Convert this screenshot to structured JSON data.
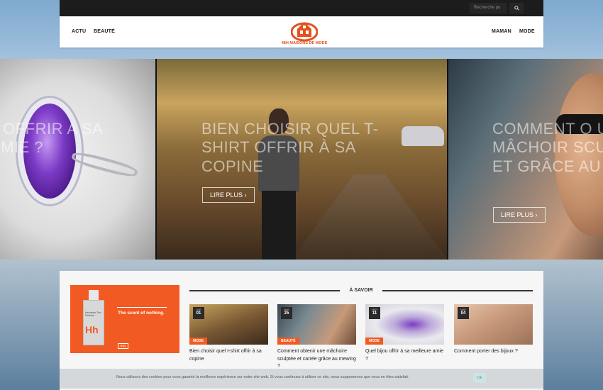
{
  "search": {
    "placeholder": "Recherche pu"
  },
  "nav": {
    "left": [
      "ACTU",
      "BEAUTÉ"
    ],
    "right": [
      "MAMAN",
      "MODE"
    ]
  },
  "logo": {
    "text": "48H MAISONS DE MODE"
  },
  "slides": [
    {
      "title": "J OFFRIR A SA AMIE ?",
      "button": ""
    },
    {
      "title": "BIEN CHOISIR QUEL T-SHIRT OFFRIR À SA COPINE",
      "button": "LIRE PLUS"
    },
    {
      "title": "COMMENT O UNE MÂCHOIR SCULPTÉE ET GRÂCE AU ME",
      "button": "LIRE PLUS"
    }
  ],
  "ad": {
    "brand": "Hernando The Perfume",
    "logo": "Hh",
    "tagline": "The scent of nothing.",
    "buy": "Buy"
  },
  "section": {
    "title": "À SAVOIR"
  },
  "articles": [
    {
      "month": "AVR",
      "day": "01",
      "category": "MODE",
      "title": "Bien choisir quel t-shirt offrir à sa copine"
    },
    {
      "month": "MAR",
      "day": "25",
      "category": "BEAUTÉ",
      "title": "Comment obtenir une mâchoire sculptée et carrée grâce au mewing ?"
    },
    {
      "month": "MAR",
      "day": "11",
      "category": "MODE",
      "title": "Quel bijou offrir à sa meilleure amie ?"
    },
    {
      "month": "MAR",
      "day": "04",
      "category": "MODE",
      "title": "Comment porter des bijoux ?"
    }
  ],
  "cookie": {
    "text": "Nous utilisons des cookies pour vous garantir la meilleure expérience sur notre site web. Si vous continuez à utiliser ce site, nous supposerons que vous en êtes satisfait.",
    "button": "Ok"
  },
  "colors": {
    "accent": "#f15a22",
    "dark": "#1c1c1c"
  }
}
